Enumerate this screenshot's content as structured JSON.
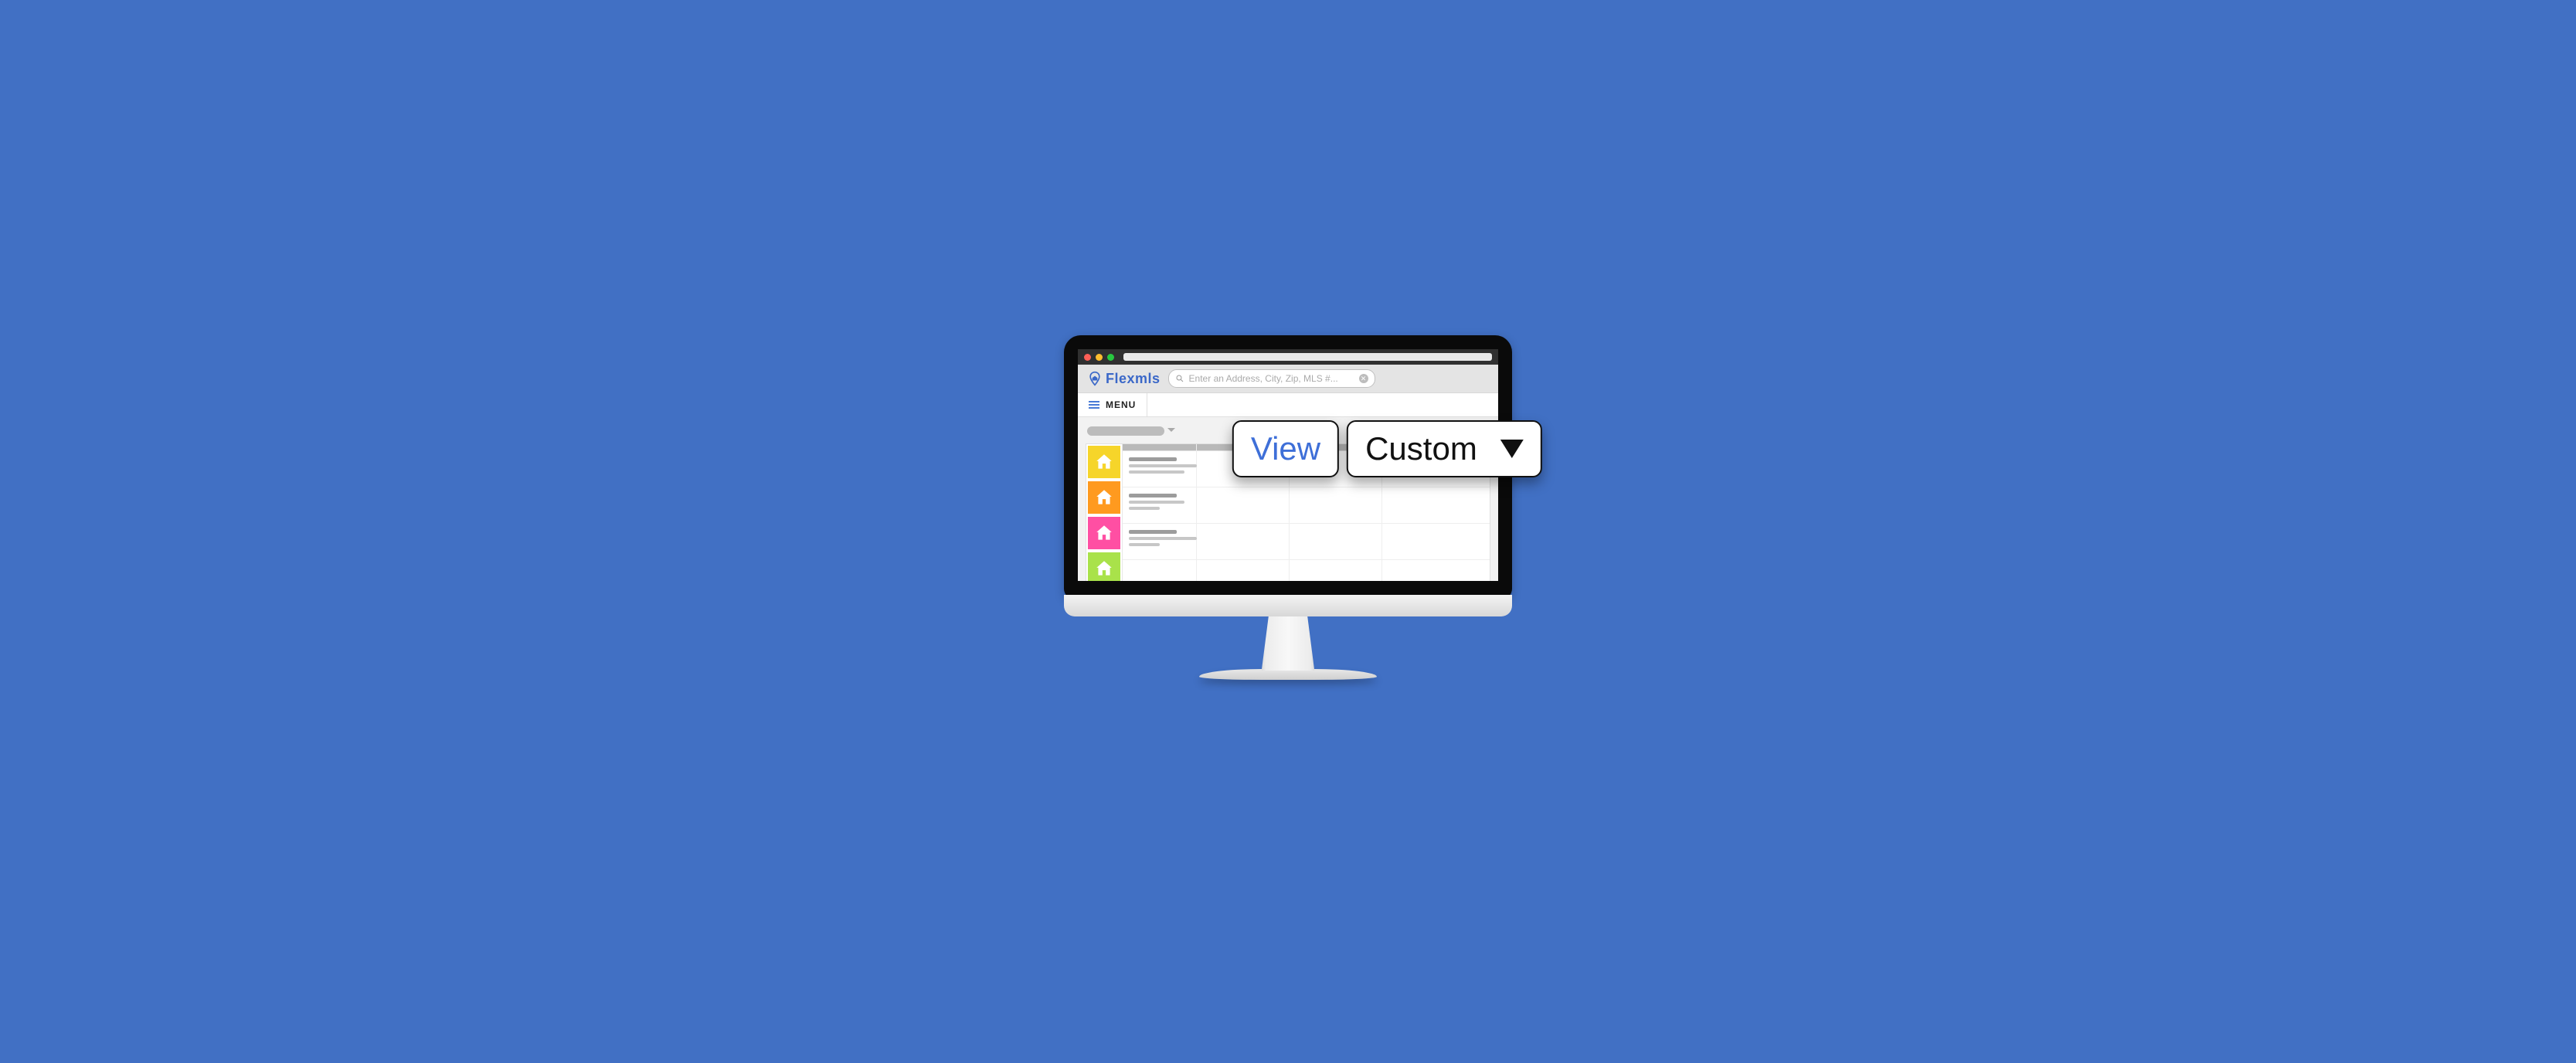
{
  "brand": {
    "name": "Flexmls"
  },
  "search": {
    "placeholder": "Enter an Address, City, Zip, MLS #..."
  },
  "menu": {
    "label": "MENU"
  },
  "callout": {
    "view_label": "View",
    "selected": "Custom"
  },
  "thumbs": [
    {
      "color": "c-yel"
    },
    {
      "color": "c-org"
    },
    {
      "color": "c-pnk"
    },
    {
      "color": "c-grn"
    }
  ]
}
